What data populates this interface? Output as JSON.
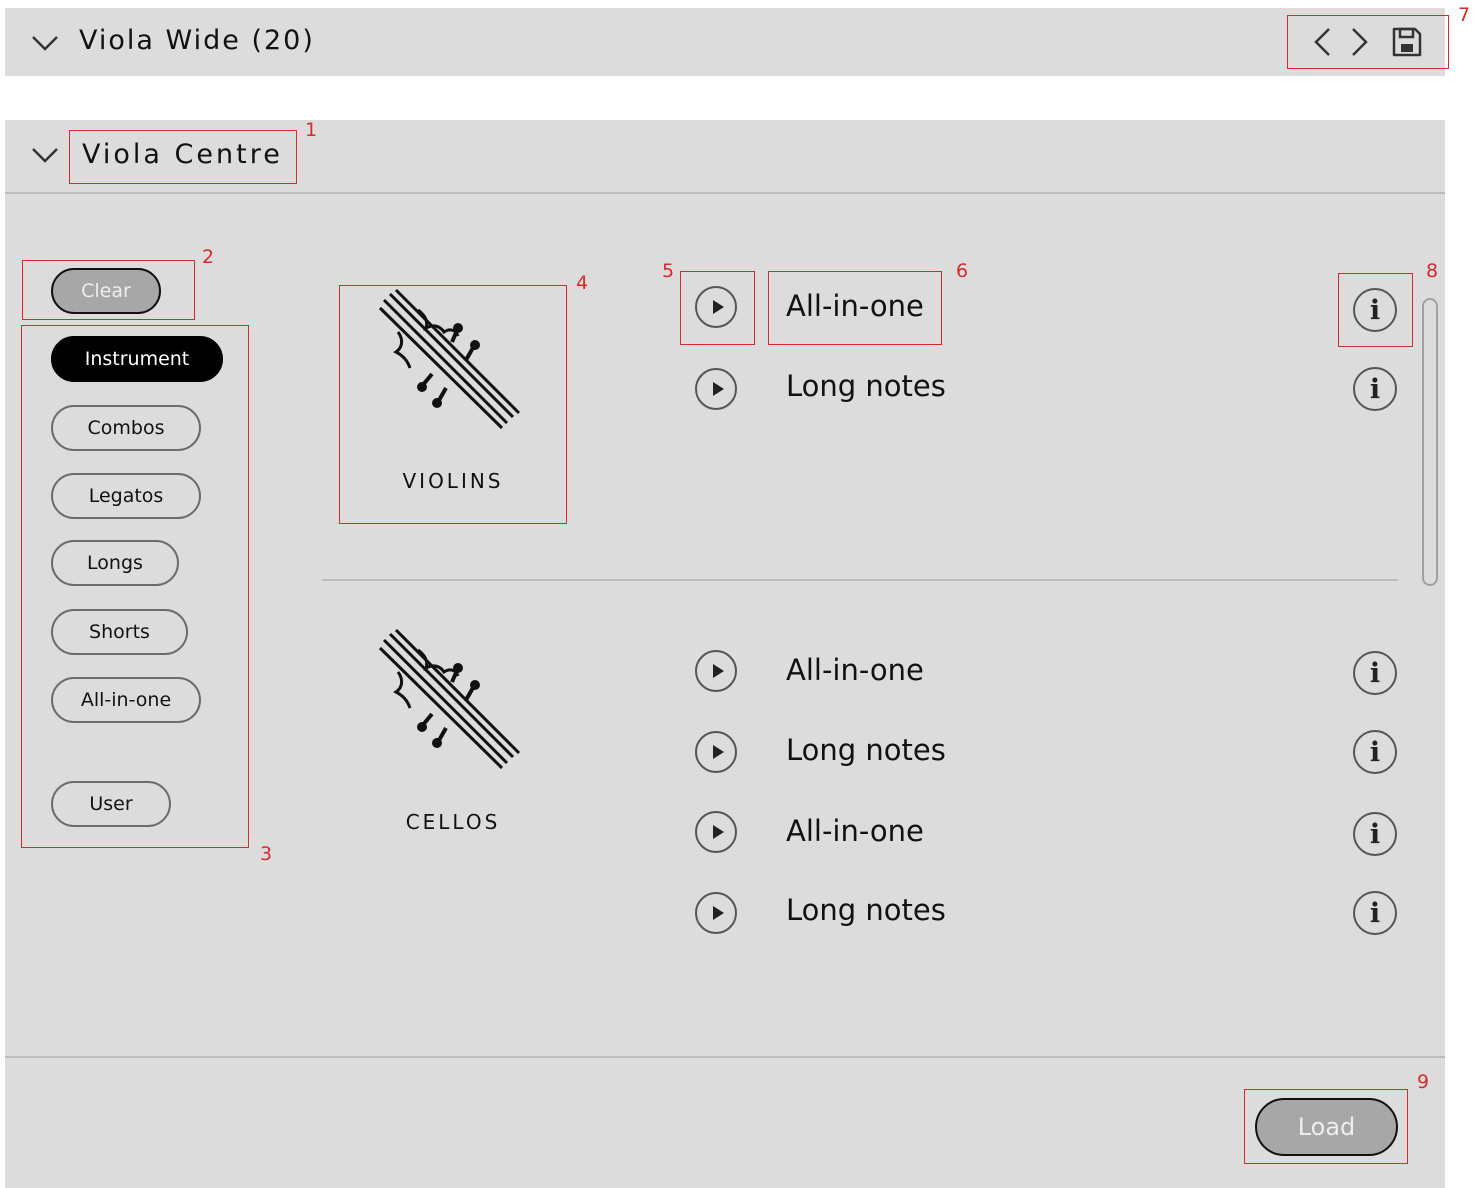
{
  "header_top": {
    "title": "Viola Wide (20)",
    "icons": [
      "chevron-down-icon",
      "chevron-left-icon",
      "chevron-right-icon",
      "save-icon"
    ]
  },
  "panel": {
    "title": "Viola Centre",
    "clear_label": "Clear",
    "load_label": "Load"
  },
  "filters": [
    {
      "label": "Instrument",
      "active": true
    },
    {
      "label": "Combos",
      "active": false
    },
    {
      "label": "Legatos",
      "active": false
    },
    {
      "label": "Longs",
      "active": false
    },
    {
      "label": "Shorts",
      "active": false
    },
    {
      "label": "All-in-one",
      "active": false
    },
    {
      "label": "User",
      "active": false
    }
  ],
  "categories": [
    {
      "label": "VIOLINS",
      "presets": [
        {
          "name": "All-in-one"
        },
        {
          "name": "Long notes"
        }
      ]
    },
    {
      "label": "CELLOS",
      "presets": [
        {
          "name": "All-in-one"
        },
        {
          "name": "Long notes"
        },
        {
          "name": "All-in-one"
        },
        {
          "name": "Long notes"
        }
      ]
    }
  ],
  "annotations": [
    "1",
    "2",
    "3",
    "4",
    "5",
    "6",
    "7",
    "8",
    "9"
  ],
  "colors": {
    "panel_bg": "#dcdcdc",
    "annotation": "#d52b2b",
    "active_pill": "#000000",
    "grey_button": "#a7a7a7"
  }
}
